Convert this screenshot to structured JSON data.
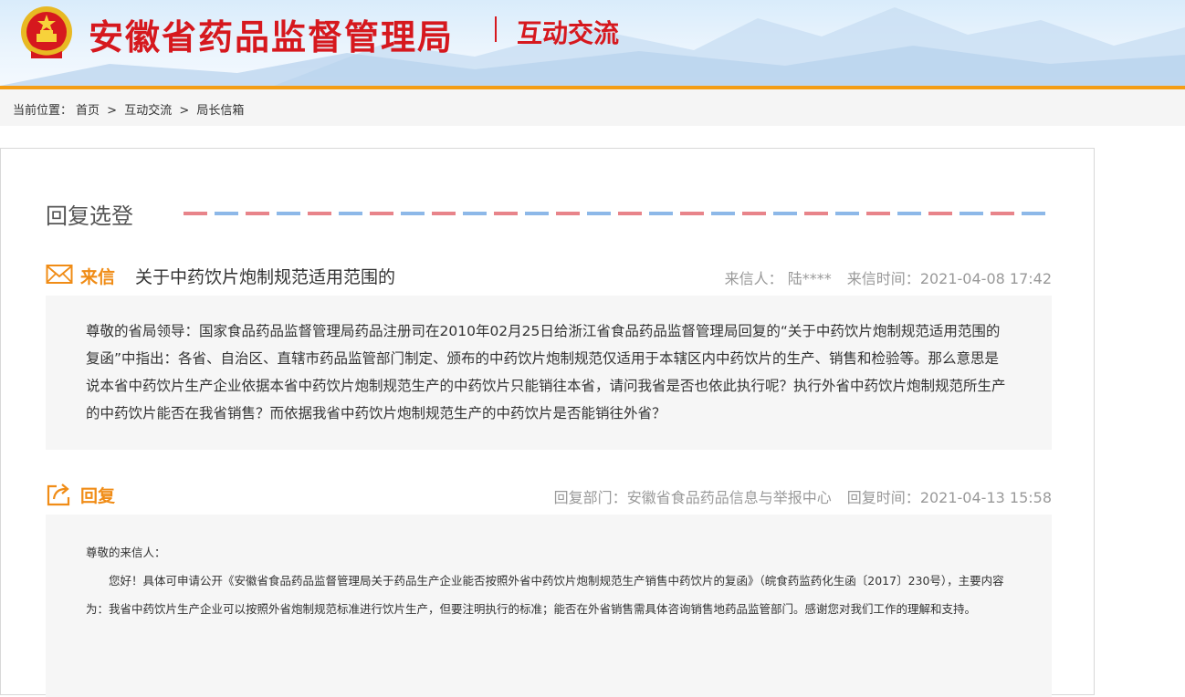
{
  "header": {
    "site_title": "安徽省药品监督管理局",
    "section_title": "互动交流",
    "accent_color": "#d6181e",
    "bar_color": "#f49d15"
  },
  "breadcrumb": {
    "label": "当前位置：",
    "items": [
      "首页",
      "互动交流",
      "局长信箱"
    ],
    "separator": ">"
  },
  "panel": {
    "heading": "回复选登"
  },
  "letter": {
    "tag": "来信",
    "subject": "关于中药饮片炮制规范适用范围的",
    "sender_label": "来信人：",
    "sender": "陆****",
    "time_label": "来信时间：",
    "time": "2021-04-08 17:42",
    "body": "尊敬的省局领导：国家食品药品监督管理局药品注册司在2010年02月25日给浙江省食品药品监督管理局回复的“关于中药饮片炮制规范适用范围的复函”中指出：各省、自治区、直辖市药品监管部门制定、颁布的中药饮片炮制规范仅适用于本辖区内中药饮片的生产、销售和检验等。那么意思是说本省中药饮片生产企业依据本省中药饮片炮制规范生产的中药饮片只能销往本省，请问我省是否也依此执行呢？执行外省中药饮片炮制规范所生产的中药饮片能否在我省销售？而依据我省中药饮片炮制规范生产的中药饮片是否能销往外省？"
  },
  "reply": {
    "tag": "回复",
    "dept_label": "回复部门：",
    "dept": "安徽省食品药品信息与举报中心",
    "time_label": "回复时间：",
    "time": "2021-04-13 15:58",
    "greeting": "尊敬的来信人：",
    "body": "您好！具体可申请公开《安徽省食品药品监督管理局关于药品生产企业能否按照外省中药饮片炮制规范生产销售中药饮片的复函》（皖食药监药化生函〔2017〕230号），主要内容为：我省中药饮片生产企业可以按照外省炮制规范标准进行饮片生产，但要注明执行的标准；能否在外省销售需具体咨询销售地药品监管部门。感谢您对我们工作的理解和支持。"
  },
  "icons": {
    "emblem": "national-emblem-icon",
    "letter": "envelope-icon",
    "reply": "share-reply-icon"
  }
}
